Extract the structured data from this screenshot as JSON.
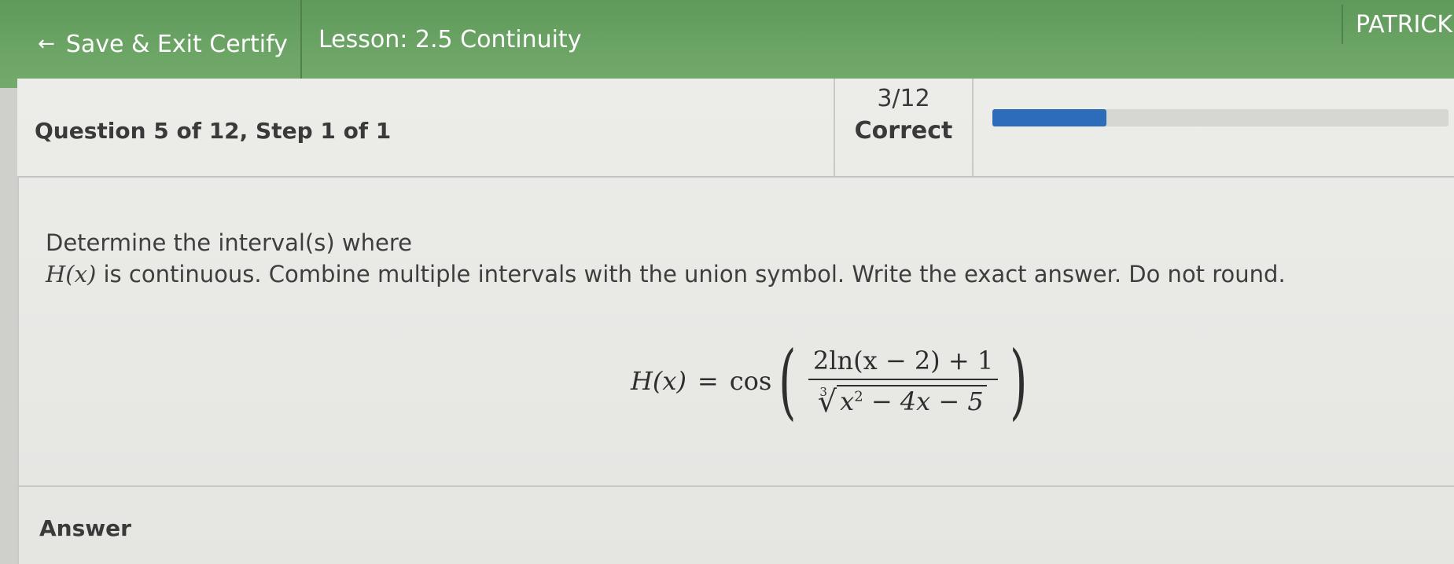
{
  "topbar": {
    "back_arrow": "←",
    "save_exit_label": "Save & Exit Certify",
    "lesson_title": "Lesson: 2.5 Continuity",
    "user_name": "PATRICK",
    "colors": {
      "bar": "#6ba465",
      "text": "#ffffff"
    }
  },
  "question_header": {
    "question_step": "Question 5 of 12, Step 1 of 1",
    "score_fraction": "3/12",
    "score_label": "Correct",
    "progress": {
      "value": 0.25,
      "fill_color": "#2c6cb8",
      "track_color": "#d6d6d3"
    }
  },
  "prompt": {
    "line1": "Determine the interval(s) where",
    "line2_function": "H(x)",
    "line2_rest": " is continuous. Combine multiple intervals with the union symbol. Write the exact answer. Do not round."
  },
  "formula": {
    "lhs": "H(x)",
    "equals": "=",
    "func": "cos",
    "open_paren": "(",
    "close_paren": ")",
    "numerator": "2ln(x − 2) + 1",
    "root_index": "3",
    "radical_sign": "√",
    "radicand_base": "x",
    "radicand_exponent": "2",
    "radicand_rest": " − 4x − 5"
  },
  "answer": {
    "label": "Answer"
  }
}
